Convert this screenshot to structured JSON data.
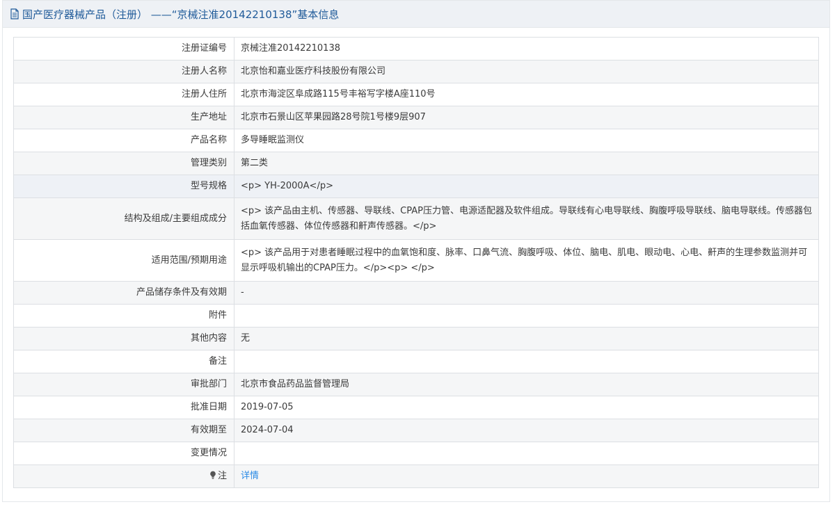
{
  "header": {
    "title": "国产医疗器械产品（注册） ——“京械注准20142210138”基本信息"
  },
  "rows": [
    {
      "label": "注册证编号",
      "value": "京械注准20142210138"
    },
    {
      "label": "注册人名称",
      "value": "北京怡和嘉业医疗科技股份有限公司"
    },
    {
      "label": "注册人住所",
      "value": "北京市海淀区阜成路115号丰裕写字楼A座110号"
    },
    {
      "label": "生产地址",
      "value": "北京市石景山区苹果园路28号院1号楼9层907"
    },
    {
      "label": "产品名称",
      "value": "多导睡眠监测仪"
    },
    {
      "label": "管理类别",
      "value": "第二类"
    },
    {
      "label": "型号规格",
      "value": "<p> YH-2000A</p>"
    },
    {
      "label": "结构及组成/主要组成成分",
      "value": "<p> 该产品由主机、传感器、导联线、CPAP压力管、电源适配器及软件组成。导联线有心电导联线、胸腹呼吸导联线、脑电导联线。传感器包括血氧传感器、体位传感器和鼾声传感器。</p>"
    },
    {
      "label": "适用范围/预期用途",
      "value": "<p> 该产品用于对患者睡眠过程中的血氧饱和度、脉率、口鼻气流、胸腹呼吸、体位、脑电、肌电、眼动电、心电、鼾声的生理参数监测并可显示呼吸机输出的CPAP压力。</p><p> </p>"
    },
    {
      "label": "产品储存条件及有效期",
      "value": "-"
    },
    {
      "label": "附件",
      "value": ""
    },
    {
      "label": "其他内容",
      "value": "无"
    },
    {
      "label": "备注",
      "value": ""
    },
    {
      "label": "审批部门",
      "value": "北京市食品药品监督管理局"
    },
    {
      "label": "批准日期",
      "value": "2019-07-05"
    },
    {
      "label": "有效期至",
      "value": "2024-07-04"
    },
    {
      "label": "变更情况",
      "value": ""
    }
  ],
  "note_row": {
    "label": "注",
    "link": "详情"
  },
  "colors": {
    "title": "#1f5a99",
    "link": "#2a8ae6",
    "header_bg": "#eef1f5"
  }
}
